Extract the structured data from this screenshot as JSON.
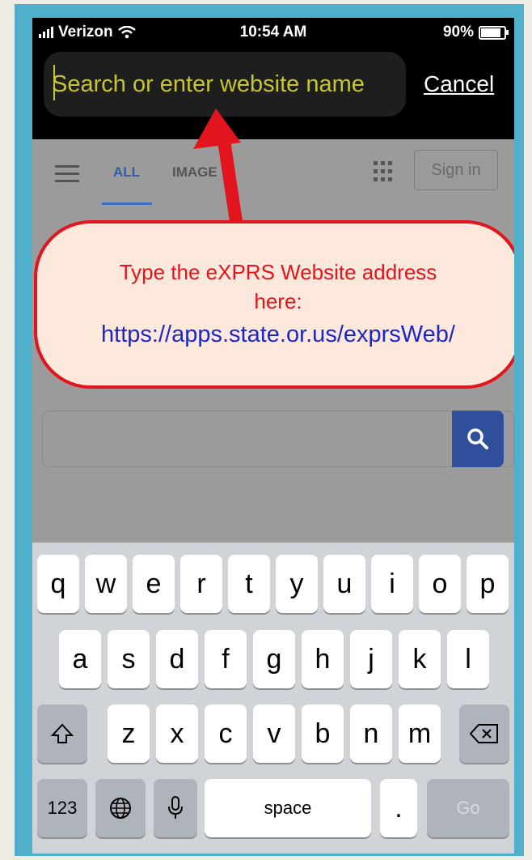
{
  "status_bar": {
    "carrier": "Verizon",
    "time": "10:54 AM",
    "battery": "90%"
  },
  "browser": {
    "address_placeholder": "Search or enter website name",
    "cancel_label": "Cancel"
  },
  "google": {
    "tab_all": "ALL",
    "tab_images": "IMAGE",
    "sign_in_label": "Sign in",
    "search_button_color": "#2f4f9c"
  },
  "callout": {
    "line1": "Type the eXPRS Website address",
    "line2": "here:",
    "url": "https://apps.state.or.us/exprsWeb/",
    "text_color": "#e2141d",
    "url_color": "#1c27c9",
    "border_color": "#e2141d"
  },
  "keyboard": {
    "row1": [
      "q",
      "w",
      "e",
      "r",
      "t",
      "y",
      "u",
      "i",
      "o",
      "p"
    ],
    "row2": [
      "a",
      "s",
      "d",
      "f",
      "g",
      "h",
      "j",
      "k",
      "l"
    ],
    "row3": [
      "z",
      "x",
      "c",
      "v",
      "b",
      "n",
      "m"
    ],
    "numbers_label": "123",
    "space_label": "space",
    "period_label": ".",
    "go_label": "Go"
  }
}
